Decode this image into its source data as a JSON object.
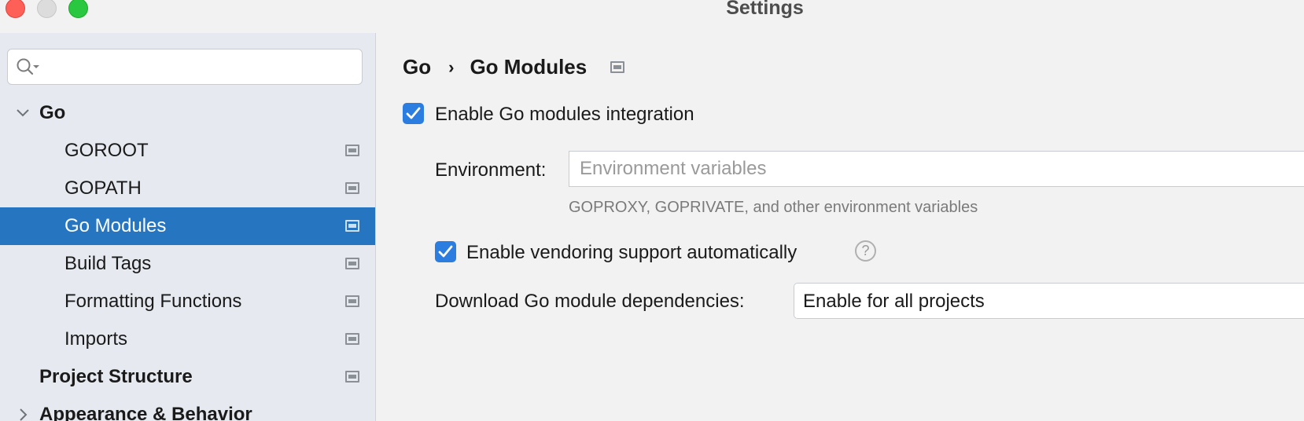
{
  "window": {
    "title": "Settings"
  },
  "sidebar": {
    "search": {
      "placeholder": ""
    },
    "items": [
      {
        "label": "Go",
        "level": 0,
        "expanded": true,
        "bold": true
      },
      {
        "label": "GOROOT",
        "level": 1
      },
      {
        "label": "GOPATH",
        "level": 1
      },
      {
        "label": "Go Modules",
        "level": 1,
        "selected": true
      },
      {
        "label": "Build Tags",
        "level": 1
      },
      {
        "label": "Formatting Functions",
        "level": 1
      },
      {
        "label": "Imports",
        "level": 1
      },
      {
        "label": "Project Structure",
        "level": 0,
        "bold": true
      },
      {
        "label": "Appearance & Behavior",
        "level": 0,
        "bold": true,
        "expanded": false
      }
    ]
  },
  "breadcrumb": {
    "parent": "Go",
    "separator": "›",
    "current": "Go Modules"
  },
  "form": {
    "enable_modules_label": "Enable Go modules integration",
    "enable_modules_checked": true,
    "environment_label": "Environment:",
    "environment_value": "",
    "environment_placeholder": "Environment variables",
    "environment_hint": "GOPROXY, GOPRIVATE, and other environment variables",
    "vendoring_label": "Enable vendoring support automatically",
    "vendoring_checked": true,
    "help_glyph": "?",
    "download_label": "Download Go module dependencies:",
    "download_value": "Enable for all projects"
  },
  "colors": {
    "accent": "#2675c1",
    "checkbox": "#2b7de0",
    "close": "#fe5f57",
    "zoom": "#2ac840"
  }
}
